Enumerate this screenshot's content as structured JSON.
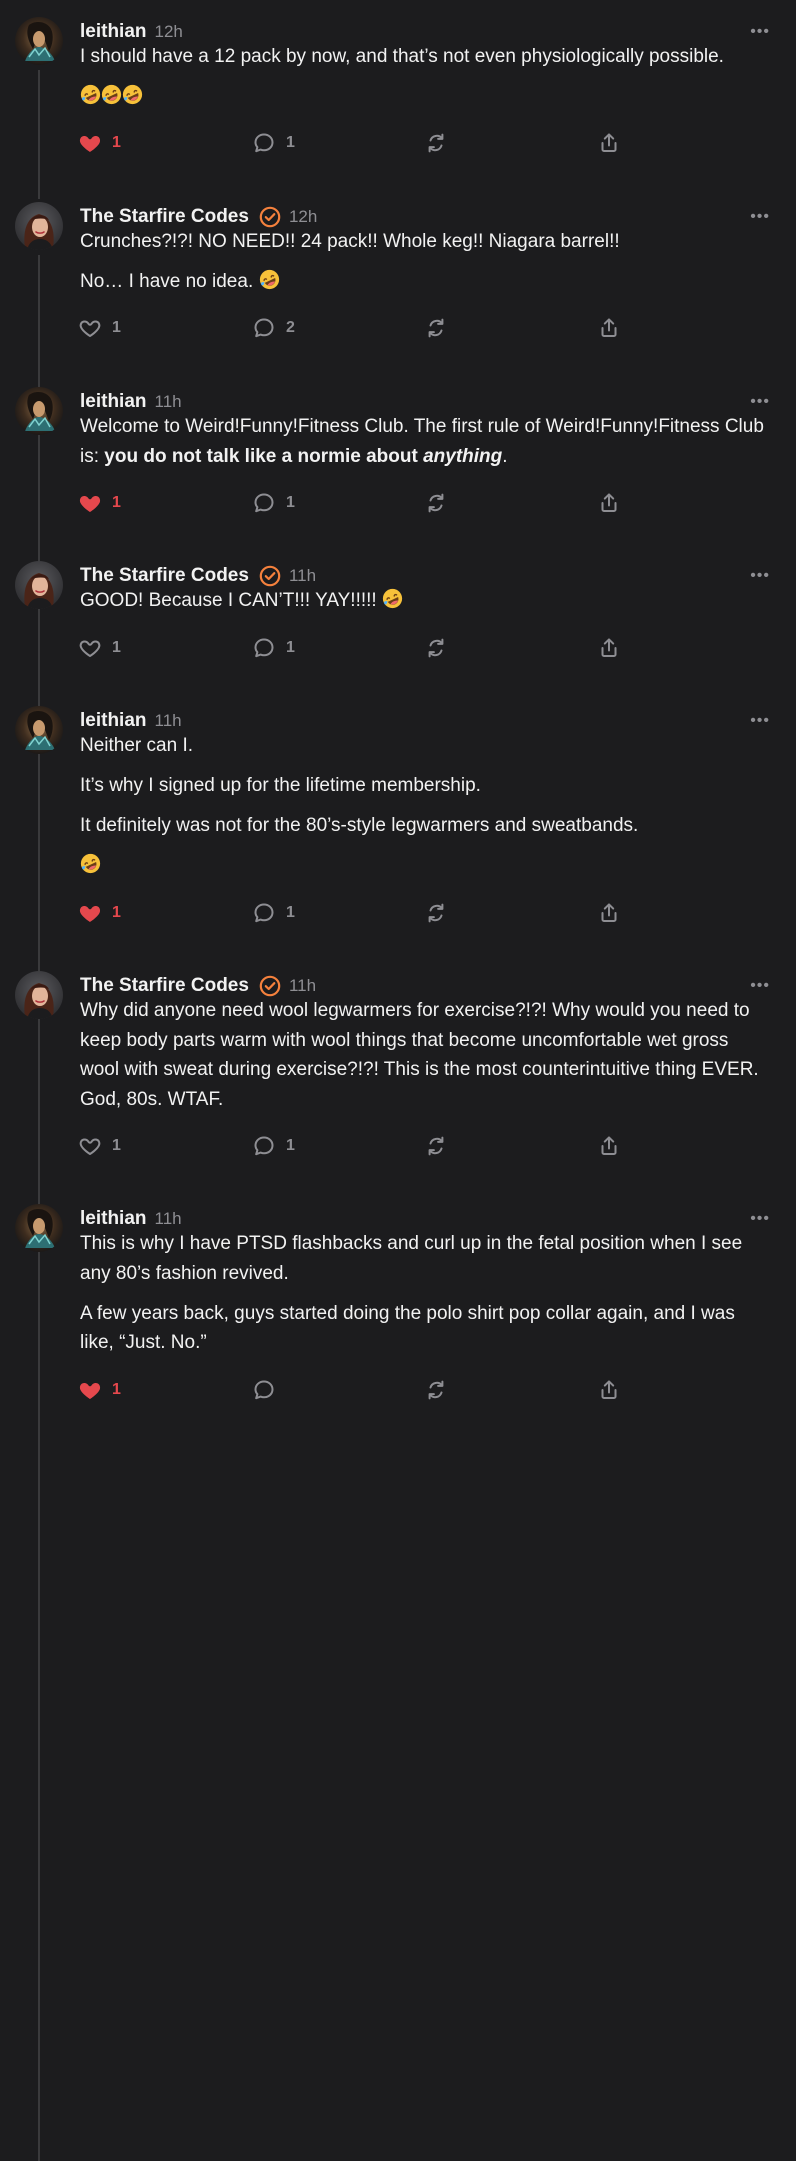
{
  "colors": {
    "background": "#1c1c1e",
    "like_active": "#e5484d",
    "verified_badge": "#f5813d",
    "muted": "#8e8e93"
  },
  "icons": {
    "like": "heart-icon",
    "reply": "speech-bubble-icon",
    "restack": "repost-icon",
    "share": "share-icon",
    "more": "more-icon",
    "verified": "verified-check-icon"
  },
  "comments": [
    {
      "author": "leithian",
      "time": "12h",
      "verified": false,
      "paragraphs": [
        "I should have a 12 pack by now, and that’s not even physiologically possible."
      ],
      "emoji_line": "🤣🤣🤣",
      "liked": true,
      "likes": "1",
      "replies": "1"
    },
    {
      "author": "The Starfire Codes",
      "time": "12h",
      "verified": true,
      "paragraphs": [
        "Crunches?!?! NO NEED!! 24 pack!! Whole keg!! Niagara barrel!!",
        "No… I have no idea."
      ],
      "liked": false,
      "likes": "1",
      "replies": "2"
    },
    {
      "author": "leithian",
      "time": "11h",
      "verified": false,
      "p1_prefix": "Welcome to Weird!Funny!Fitness Club. The first rule of Weird!Funny!Fitness Club is: ",
      "p1_bold": "you do not talk like a normie about ",
      "p1_bold_italic": "anything",
      "p1_suffix": ".",
      "liked": true,
      "likes": "1",
      "replies": "1"
    },
    {
      "author": "The Starfire Codes",
      "time": "11h",
      "verified": true,
      "paragraphs": [
        "GOOD! Because I CAN’T!!! YAY!!!!!"
      ],
      "liked": false,
      "likes": "1",
      "replies": "1"
    },
    {
      "author": "leithian",
      "time": "11h",
      "verified": false,
      "paragraphs": [
        "Neither can I.",
        "It’s why I signed up for the lifetime membership.",
        "It definitely was not for the 80’s-style legwarmers and sweatbands."
      ],
      "emoji_line": "🤣",
      "liked": true,
      "likes": "1",
      "replies": "1"
    },
    {
      "author": "The Starfire Codes",
      "time": "11h",
      "verified": true,
      "paragraphs": [
        "Why did anyone need wool legwarmers for exercise?!?! Why would you need to keep body parts warm with wool things that become uncomfortable wet gross wool with sweat during exercise?!?! This is the most counterintuitive thing EVER. God, 80s. WTAF."
      ],
      "liked": false,
      "likes": "1",
      "replies": "1"
    },
    {
      "author": "leithian",
      "time": "11h",
      "verified": false,
      "paragraphs": [
        "This is why I have PTSD flashbacks and curl up in the fetal position when I see any 80’s fashion revived.",
        "A few years back, guys started doing the polo shirt pop collar again, and I was like, “Just. No.”"
      ],
      "liked": true,
      "likes": "1",
      "replies": ""
    }
  ]
}
